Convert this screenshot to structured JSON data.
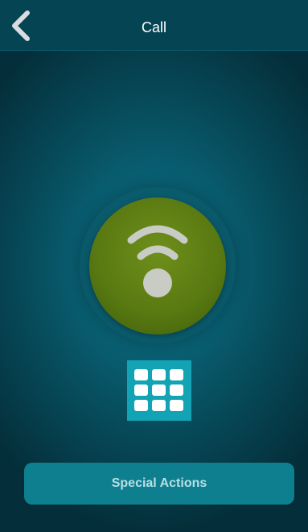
{
  "header": {
    "title": "Call",
    "back_icon": "chevron-left-icon"
  },
  "main": {
    "call_icon": "wifi-signal-icon",
    "keypad_icon": "dialpad-icon"
  },
  "actions": {
    "special_actions_label": "Special Actions"
  },
  "colors": {
    "background": "#085b6d",
    "navbar": "#054453",
    "call_button": "#5a7a12",
    "keypad_button": "#12a3b4",
    "special_button": "#0e7f8f"
  }
}
